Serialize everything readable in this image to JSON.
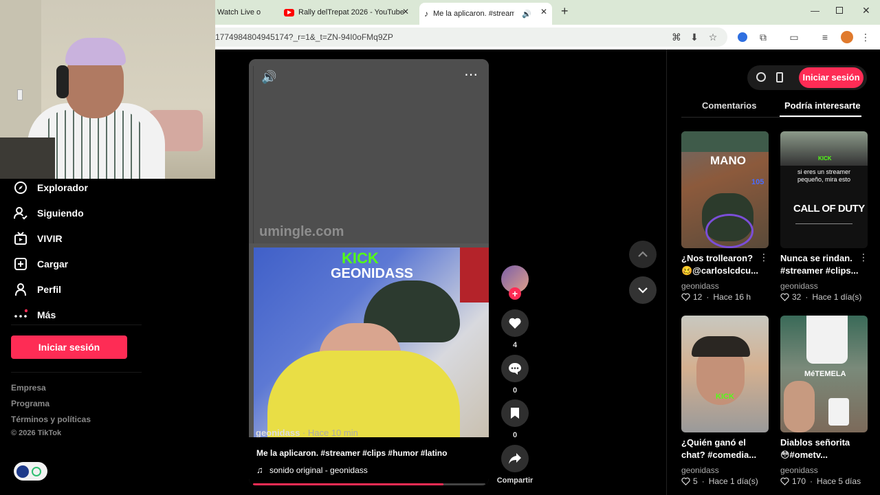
{
  "browser": {
    "tabs": [
      {
        "title": "Watch Live o",
        "close": "✕"
      },
      {
        "title": "Rally delTrepat 2026 - YouTube",
        "close": "✕"
      },
      {
        "title": "Me la aplicaron. #streamer",
        "close": "✕"
      }
    ],
    "new_tab": "+",
    "url": "1774984804945174?_r=1&_t=ZN-94I0oFMq9ZP"
  },
  "sidebar": {
    "items": [
      {
        "label": "Explorador",
        "icon": "compass-icon"
      },
      {
        "label": "Siguiendo",
        "icon": "user-follow-icon"
      },
      {
        "label": "VIVIR",
        "icon": "live-tv-icon"
      },
      {
        "label": "Cargar",
        "icon": "upload-plus-icon"
      },
      {
        "label": "Perfil",
        "icon": "profile-icon"
      },
      {
        "label": "Más",
        "icon": "more-dots-icon"
      }
    ],
    "login": "Iniciar sesión",
    "footer": [
      "Empresa",
      "Programa",
      "Términos y políticas",
      "© 2026 TikTok"
    ]
  },
  "video": {
    "watermark": "umingle.com",
    "kick": "KICK",
    "channel": "GEONIDASS",
    "overlay_author": "geonidass",
    "overlay_time": "· Hace 10 min",
    "caption": "Me la aplicaron. #streamer #clips #humor #latino",
    "sound": "sonido original - geonidass",
    "progress": 0.82
  },
  "actions": {
    "likes": "4",
    "comments": "0",
    "saves": "0",
    "share": "Compartir"
  },
  "right": {
    "login": "Iniciar sesión",
    "tabs": [
      "Comentarios",
      "Podría interesarte"
    ],
    "cards": [
      {
        "title": "¿Nos trollearon?",
        "title2": "🥴@carloslcdcu...",
        "author": "geonidass",
        "likes": "12",
        "time": "Hace 16 h",
        "thumb_text": "MANO",
        "thumb_num": "105"
      },
      {
        "title": "Nunca se rindan.",
        "title2": "#streamer #clips...",
        "author": "geonidass",
        "likes": "32",
        "time": "Hace 1 día(s)",
        "thumb_text": "si eres un streamer pequeño, mira esto",
        "thumb_brand": "CALL OF DUTY",
        "thumb_kick": "KICK"
      },
      {
        "title": "¿Quién ganó el",
        "title2": "chat? #comedia...",
        "author": "geonidass",
        "likes": "5",
        "time": "Hace 1 día(s)",
        "thumb_kick": "KICK"
      },
      {
        "title": "Diablos señorita",
        "title2": "😳#ometv...",
        "author": "geonidass",
        "likes": "170",
        "time": "Hace 5 días",
        "thumb_text": "MéTEMELA"
      }
    ]
  }
}
